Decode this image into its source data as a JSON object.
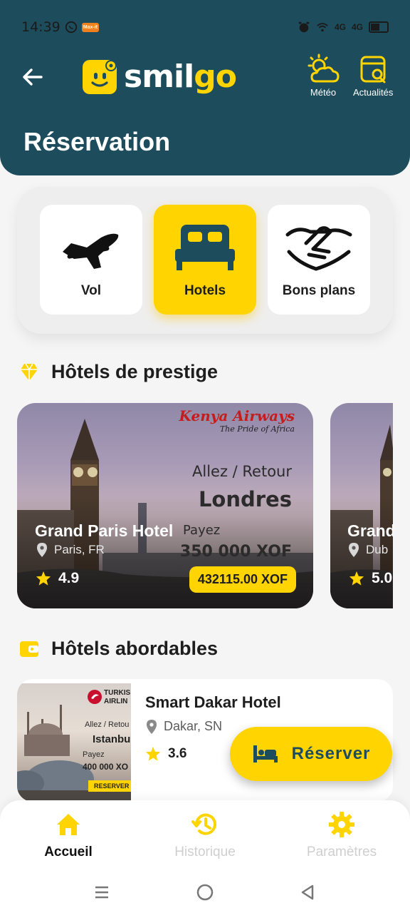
{
  "status_bar": {
    "time": "14:39",
    "badge": "Max-it",
    "net1": "4G",
    "net2": "4G",
    "battery": "5"
  },
  "header": {
    "logo_main": "smil",
    "logo_accent": "go",
    "weather_label": "Météo",
    "news_label": "Actualités",
    "page_title": "Réservation"
  },
  "categories": [
    {
      "label": "Vol",
      "icon": "plane-icon",
      "active": false
    },
    {
      "label": "Hotels",
      "icon": "bed-icon",
      "active": true
    },
    {
      "label": "Bons plans",
      "icon": "handshake-icon",
      "active": false
    }
  ],
  "prestige": {
    "title": "Hôtels de prestige",
    "cards": [
      {
        "name": "Grand Paris Hotel",
        "location": "Paris, FR",
        "rating": "4.9",
        "price": "432115.00 XOF",
        "ad": {
          "airline": "Kenya Airways",
          "tagline": "The Pride of Africa",
          "route": "Allez / Retour",
          "city": "Londres",
          "pay": "Payez",
          "amount": "350 000 XOF"
        }
      },
      {
        "name": "Grand",
        "location": "Dub",
        "rating": "5.0"
      }
    ]
  },
  "affordable": {
    "title": "Hôtels abordables",
    "cards": [
      {
        "name": "Smart Dakar Hotel",
        "location": "Dakar, SN",
        "rating": "3.6",
        "ad": {
          "airline_line1": "TURKIS",
          "airline_line2": "AIRLIN",
          "route": "Allez / Retou",
          "city": "Istanbu",
          "pay": "Payez",
          "amount": "400 000 XO",
          "cta": "RESERVER"
        }
      }
    ]
  },
  "reserve_button": {
    "label": "Réserver"
  },
  "bottom_nav": [
    {
      "label": "Accueil",
      "active": true
    },
    {
      "label": "Historique",
      "active": false
    },
    {
      "label": "Paramètres",
      "active": false
    }
  ],
  "colors": {
    "primary": "#1d4d5c",
    "accent": "#ffd400",
    "background": "#f5f5f5"
  }
}
